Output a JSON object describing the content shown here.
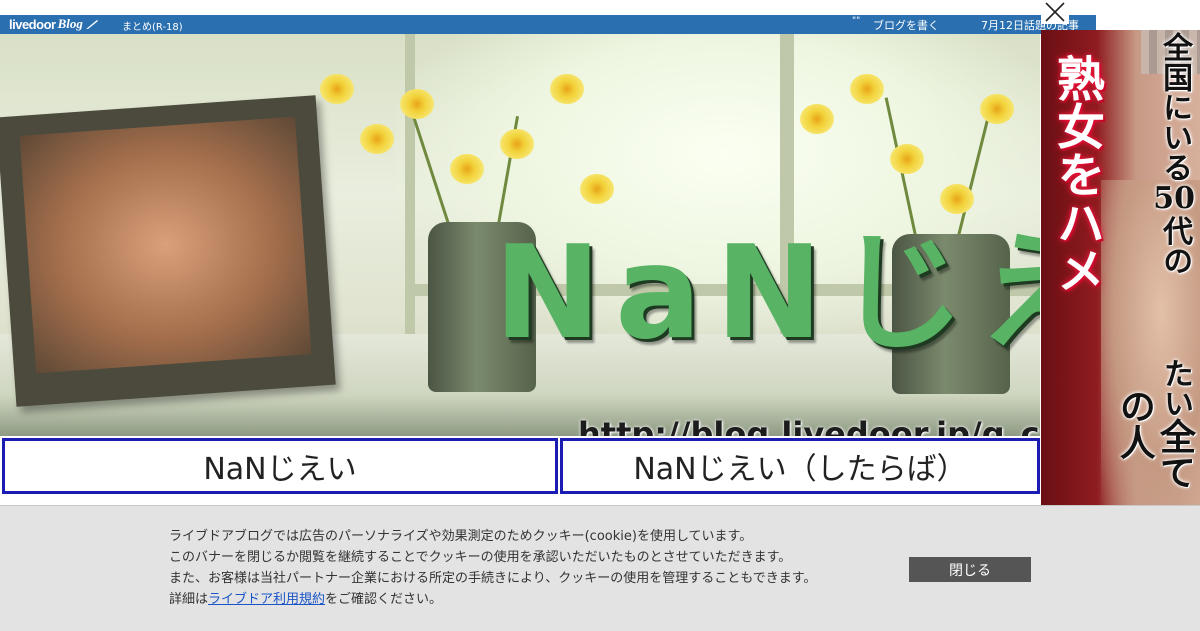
{
  "topbar": {
    "logo_word1": "livedoor",
    "logo_word2": "Blog",
    "matome": "まとめ(R-18)",
    "dots": "\"\"",
    "write_blog": "ブログを書く",
    "topic": "7月12日話題の記事"
  },
  "banner": {
    "title": "NaNじえい",
    "url": "http://blog.livedoor.jp/g_c"
  },
  "links": [
    {
      "label": "NaNじえい"
    },
    {
      "label": "NaNじえい（したらば）"
    }
  ],
  "ad": {
    "col1": "熟女をハメ",
    "col2_a": "全国にいる",
    "col2_num": "50",
    "col2_b": "代の",
    "col2_c": "たい",
    "col2_d": "全ての人"
  },
  "cookie": {
    "line1": "ライブドアブログでは広告のパーソナライズや効果測定のためクッキー(cookie)を使用しています。",
    "line2": "このバナーを閉じるか閲覧を継続することでクッキーの使用を承認いただいたものとさせていただきます。",
    "line3": "また、お客様は当社パートナー企業における所定の手続きにより、クッキーの使用を管理することもできます。",
    "line4_pre": "詳細は",
    "line4_link": "ライブドア利用規約",
    "line4_post": "をご確認ください。",
    "close_label": "閉じる"
  },
  "colors": {
    "topbar": "#2a6fb0",
    "title_green": "#58b364",
    "link_border": "#1c1cb3",
    "cookie_bg": "#e3e3e3",
    "close_btn": "#555555"
  }
}
